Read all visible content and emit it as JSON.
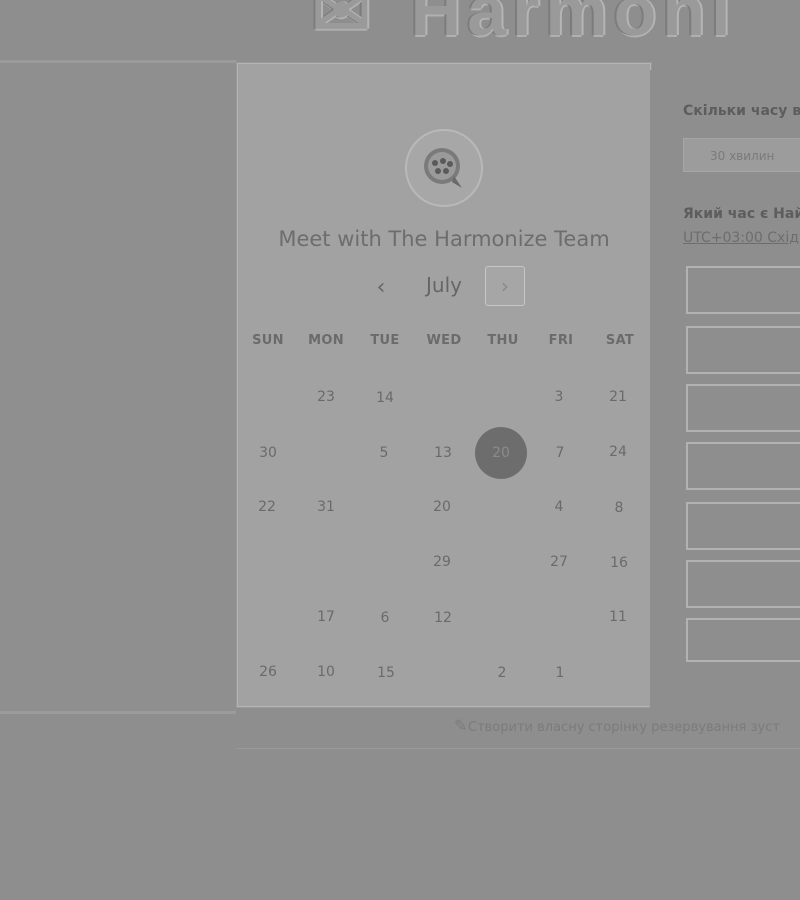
{
  "background": {
    "logo_text": "Harmoni",
    "colors": {
      "page": "#8e8e8e",
      "card": "#a2a2a2",
      "selected_day": "#6d6d6d"
    }
  },
  "card": {
    "title": "Meet with The Harmonize Team",
    "avatar_icon": "company-logo-icon",
    "month": "July",
    "prev_icon": "chevron-left-icon",
    "next_icon": "chevron-right-icon",
    "weekdays": [
      "SUN",
      "MON",
      "TUE",
      "WED",
      "THU",
      "FRI",
      "SAT"
    ],
    "days": [
      {
        "text": "23"
      },
      {
        "text": "14"
      },
      {
        "text": "3"
      },
      {
        "text": "21"
      },
      {
        "text": "30"
      },
      {
        "text": "5"
      },
      {
        "text": "13"
      },
      {
        "text": "20"
      },
      {
        "text": "7"
      },
      {
        "text": "24"
      },
      {
        "text": "22"
      },
      {
        "text": "31"
      },
      {
        "text": "20"
      },
      {
        "text": "4"
      },
      {
        "text": "8"
      },
      {
        "text": "29"
      },
      {
        "text": "27"
      },
      {
        "text": "16"
      },
      {
        "text": "17"
      },
      {
        "text": "6"
      },
      {
        "text": "12"
      },
      {
        "text": "11"
      },
      {
        "text": "26"
      },
      {
        "text": "10"
      },
      {
        "text": "15"
      },
      {
        "text": "2"
      },
      {
        "text": "1"
      }
    ],
    "selected_day": "20"
  },
  "right_panel": {
    "duration_question": "Скільки часу в",
    "duration_value": "30 хвилин",
    "time_question": "Який час є Най",
    "timezone": "UTC+03:00 Схід"
  },
  "footer": {
    "link": "Створити власну сторінку резервування зуст"
  }
}
